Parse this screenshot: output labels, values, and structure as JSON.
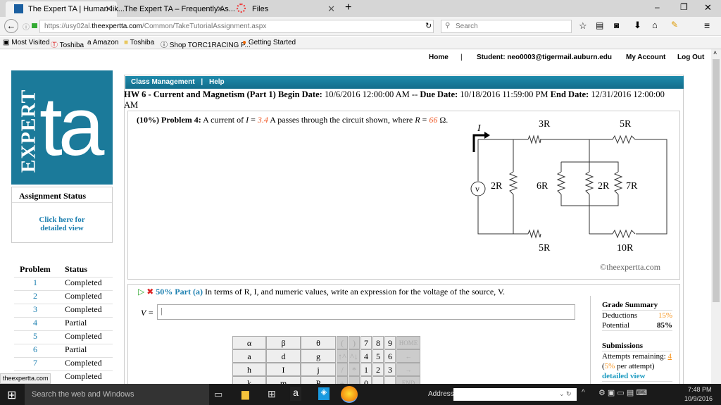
{
  "browser": {
    "tabs": [
      {
        "label": "The Expert TA | Human-lik..."
      },
      {
        "label": "The Expert TA – Frequently As..."
      },
      {
        "label": "Files"
      }
    ],
    "url_host_pre": "https://usy02al.",
    "url_host": "theexpertta.com",
    "url_path": "/Common/TakeTutorialAssignment.aspx",
    "search_placeholder": "Search",
    "bookmarks": [
      "Most Visited",
      "Toshiba",
      "Amazon",
      "Toshiba",
      "Shop TORC1RACING P...",
      "Getting Started"
    ]
  },
  "topnav": {
    "home": "Home",
    "sep": "|",
    "student": "Student: neo0003@tigermail.auburn.edu",
    "account": "My Account",
    "logout": "Log Out"
  },
  "logo": {
    "expert": "EXPERT",
    "ta": "ta"
  },
  "sidebar": {
    "status_title": "Assignment Status",
    "click_here": "Click here for detailed view",
    "col_problem": "Problem",
    "col_status": "Status",
    "problems": [
      {
        "n": "1",
        "s": "Completed"
      },
      {
        "n": "2",
        "s": "Completed"
      },
      {
        "n": "3",
        "s": "Completed"
      },
      {
        "n": "4",
        "s": "Partial"
      },
      {
        "n": "5",
        "s": "Completed"
      },
      {
        "n": "6",
        "s": "Partial"
      },
      {
        "n": "7",
        "s": "Completed"
      },
      {
        "n": "8",
        "s": "Completed"
      }
    ]
  },
  "menu": {
    "class_mgmt": "Class Management",
    "sep": "|",
    "help": "Help"
  },
  "assignment": {
    "title": "HW 6 - Current and Magnetism (Part 1)",
    "begin_label": "Begin Date:",
    "begin": "10/6/2016 12:00:00 AM",
    "sep": "--",
    "due_label": "Due Date:",
    "due": "10/18/2016 11:59:00 PM",
    "end_label": "End Date:",
    "end": "12/31/2016 12:00:00 AM"
  },
  "problem": {
    "pct": "(10%)",
    "label": "Problem 4:",
    "text1": "A current of",
    "I": "I",
    "eq": "=",
    "I_val": "3.4",
    "text2": "A passes through the circuit shown, where",
    "R": "R",
    "R_val": "66",
    "unit": "Ω."
  },
  "circuit": {
    "I": "I",
    "V": "v",
    "r_3R": "3R",
    "r_5R_top": "5R",
    "r_2R_left": "2R",
    "r_6R": "6R",
    "r_2R_mid": "2R",
    "r_7R": "7R",
    "r_5R_bot": "5R",
    "r_10R": "10R",
    "copyright": "©theexpertta.com"
  },
  "part": {
    "pct": "50% Part (a)",
    "text": "In terms of R, I, and numeric values, write an expression for the voltage of the source, V.",
    "input_label": "V =",
    "input_value": ""
  },
  "keypad": [
    [
      "α",
      "β",
      "θ",
      "(",
      ")",
      "7",
      "8",
      "9",
      "HOME"
    ],
    [
      "a",
      "d",
      "g",
      "↑^",
      "^↓",
      "4",
      "5",
      "6",
      "←"
    ],
    [
      "h",
      "I",
      "j",
      "/",
      "*",
      "1",
      "2",
      "3",
      "→"
    ],
    [
      "k",
      "m",
      "P",
      "+",
      "",
      "0",
      "",
      "",
      "END"
    ]
  ],
  "grade": {
    "title": "Grade Summary",
    "deductions_label": "Deductions",
    "deductions": "15%",
    "potential_label": "Potential",
    "potential": "85%",
    "sub_title": "Submissions",
    "attempts_label": "Attempts remaining:",
    "attempts": "4",
    "per_attempt_pct": "5%",
    "per_attempt": "per attempt)",
    "detailed": "detailed view",
    "partial_row": "5%"
  },
  "statusbar_url": "theexpertta.com",
  "taskbar": {
    "search": "Search the web and Windows",
    "address": "Address",
    "time": "7:48 PM",
    "date": "10/9/2016"
  },
  "colors": {
    "accent": "#1b7a9a",
    "highlight": "#f05a28",
    "orange": "#f7941d"
  }
}
